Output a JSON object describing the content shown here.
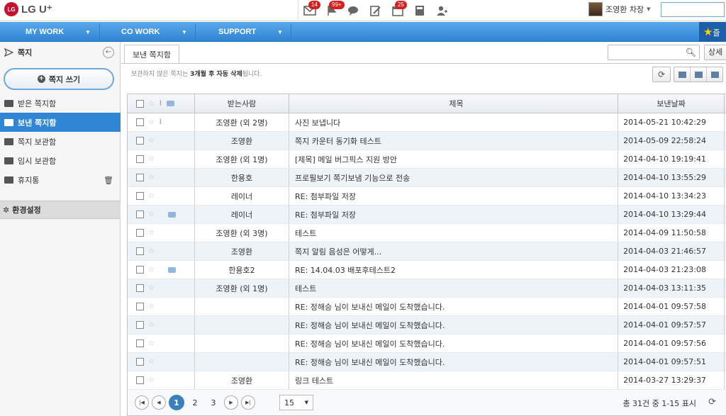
{
  "brand": {
    "logo_mark": "LG",
    "name": "LG U⁺"
  },
  "top_icons": [
    {
      "name": "mail-icon",
      "badge": "14"
    },
    {
      "name": "flag-icon",
      "badge": "99+"
    },
    {
      "name": "chat-icon",
      "badge": ""
    },
    {
      "name": "edit-icon",
      "badge": ""
    },
    {
      "name": "calendar-icon",
      "badge": "25"
    },
    {
      "name": "calculator-icon",
      "badge": ""
    },
    {
      "name": "add-user-icon",
      "badge": ""
    }
  ],
  "user": {
    "name": "조영환 차장"
  },
  "nav": {
    "items": [
      "MY WORK",
      "CO WORK",
      "SUPPORT"
    ],
    "fav_label": "즐"
  },
  "sidebar": {
    "title": "쪽지",
    "compose_label": "쪽지 쓰기",
    "items": [
      "받은 쪽지함",
      "보낸 쪽지함",
      "쪽지 보관함",
      "임시 보관함",
      "휴지통"
    ],
    "settings": "환경설정"
  },
  "main": {
    "tab": "보낸 쪽지함",
    "search_placeholder": "",
    "detail_label": "상세",
    "notice_pre": "보관하지 않은 쪽지는 ",
    "notice_bold": "3개월 후 자동 삭제",
    "notice_post": "됩니다."
  },
  "table": {
    "headers": [
      "",
      "받는사람",
      "제목",
      "보낸날짜"
    ],
    "rows": [
      {
        "recipient": "조영환 (외 2명)",
        "subject": "사진 보냅니다",
        "date": "2014-05-21 10:42:29",
        "clip": true,
        "bubble": false
      },
      {
        "recipient": "조영환",
        "subject": "쪽지 카운터 동기화 테스트",
        "date": "2014-05-09 22:58:24",
        "clip": false,
        "bubble": false
      },
      {
        "recipient": "조영환 (외 1명)",
        "subject": "[제목] 메일 버그픽스 지원 방안",
        "date": "2014-04-10 19:19:41",
        "clip": false,
        "bubble": false
      },
      {
        "recipient": "한용호",
        "subject": "프로필보기 쪽기보냄 기능으로 전송",
        "date": "2014-04-10 13:55:29",
        "clip": false,
        "bubble": false
      },
      {
        "recipient": "레이너",
        "subject": "RE: 첨부파일 저장",
        "date": "2014-04-10 13:34:23",
        "clip": false,
        "bubble": false
      },
      {
        "recipient": "레이너",
        "subject": "RE: 첨부파일 저장",
        "date": "2014-04-10 13:29:44",
        "clip": false,
        "bubble": true
      },
      {
        "recipient": "조영환 (외 3명)",
        "subject": "테스트",
        "date": "2014-04-09 11:50:58",
        "clip": false,
        "bubble": false
      },
      {
        "recipient": "조영환",
        "subject": "쪽지 알림 음성은 어떻게...",
        "date": "2014-04-03 21:46:57",
        "clip": false,
        "bubble": false
      },
      {
        "recipient": "한용호2",
        "subject": "RE: 14.04.03 배포후테스트2",
        "date": "2014-04-03 21:23:08",
        "clip": false,
        "bubble": true
      },
      {
        "recipient": "조영환 (외 1명)",
        "subject": "테스트",
        "date": "2014-04-03 13:11:35",
        "clip": false,
        "bubble": false
      },
      {
        "recipient": "",
        "subject": "RE: 정해승 님이 보내신 메일이 도착했습니다.",
        "date": "2014-04-01 09:57:58",
        "clip": false,
        "bubble": false
      },
      {
        "recipient": "",
        "subject": "RE: 정해승 님이 보내신 메일이 도착했습니다.",
        "date": "2014-04-01 09:57:57",
        "clip": false,
        "bubble": false
      },
      {
        "recipient": "",
        "subject": "RE: 정해승 님이 보내신 메일이 도착했습니다.",
        "date": "2014-04-01 09:57:56",
        "clip": false,
        "bubble": false
      },
      {
        "recipient": "",
        "subject": "RE: 정해승 님이 보내신 메일이 도착했습니다.",
        "date": "2014-04-01 09:57:51",
        "clip": false,
        "bubble": false
      },
      {
        "recipient": "조영환",
        "subject": "링크 테스트",
        "date": "2014-03-27 13:29:37",
        "clip": false,
        "bubble": false
      }
    ]
  },
  "pagination": {
    "pages": [
      "1",
      "2",
      "3"
    ],
    "current": "1",
    "per_page": "15",
    "total": "총 31건 중 1-15 표시"
  }
}
